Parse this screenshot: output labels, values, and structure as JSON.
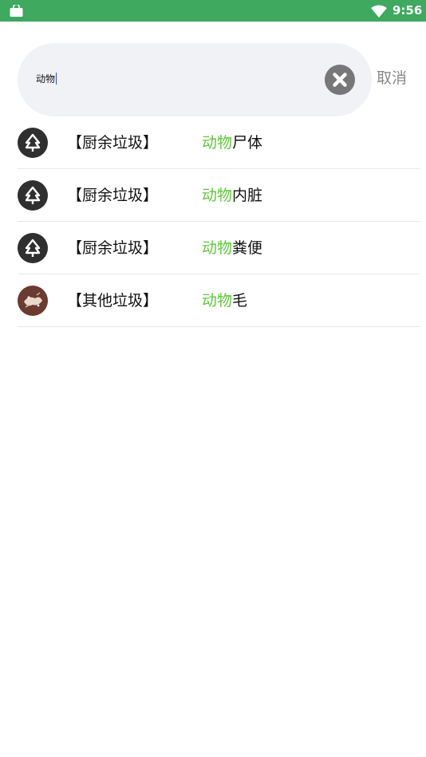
{
  "status_bar": {
    "time": "9:56",
    "bg_color": "#3ea95f",
    "left_icon": "shopping-bag-icon",
    "wifi_icon": "wifi-icon"
  },
  "search": {
    "query": "动物",
    "clear_icon": "clear-circle-icon",
    "cancel_label": "取消"
  },
  "results": [
    {
      "icon": "kitchen-waste-icon",
      "category": "【厨余垃圾】",
      "match": "动物",
      "rest": "尸体"
    },
    {
      "icon": "kitchen-waste-icon",
      "category": "【厨余垃圾】",
      "match": "动物",
      "rest": "内脏"
    },
    {
      "icon": "kitchen-waste-icon",
      "category": "【厨余垃圾】",
      "match": "动物",
      "rest": "粪便"
    },
    {
      "icon": "other-waste-icon",
      "category": "【其他垃圾】",
      "match": "动物",
      "rest": "毛"
    }
  ],
  "colors": {
    "highlight": "#5fc83a",
    "search_bg": "#f1f2f6",
    "divider": "#e6e6e6"
  }
}
